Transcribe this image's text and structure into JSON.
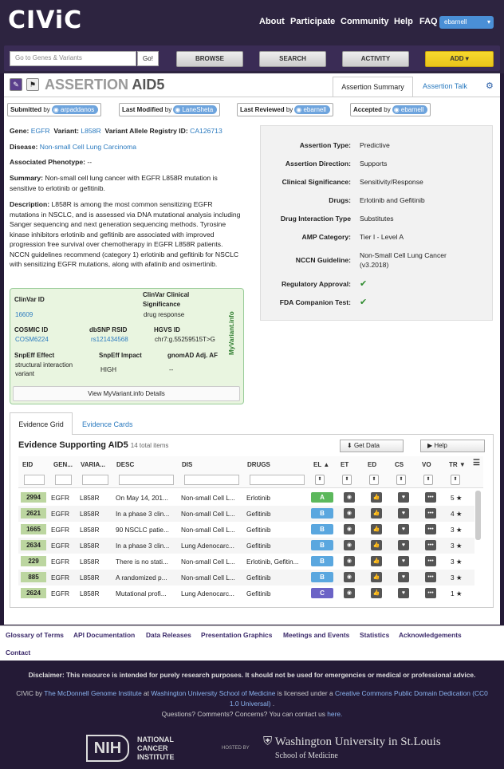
{
  "header": {
    "logo": "CIViC",
    "nav": [
      "About",
      "Participate",
      "Community",
      "Help",
      "FAQ"
    ],
    "user": "ebarnell"
  },
  "toolbar": {
    "search_placeholder": "Go to Genes & Variants",
    "go": "Go!",
    "browse": "BROWSE",
    "search": "SEARCH",
    "activity": "ACTIVITY",
    "add": "ADD"
  },
  "assertion": {
    "label": "ASSERTION",
    "id": "AID5"
  },
  "tabs": {
    "summary": "Assertion Summary",
    "talk": "Assertion Talk"
  },
  "chips": {
    "submitted": "Submitted",
    "submitted_user": "arpaddanos",
    "modified": "Last Modified",
    "modified_user": "LaneSheta",
    "reviewed": "Last Reviewed",
    "reviewed_user": "ebarnell",
    "accepted": "Accepted",
    "accepted_user": "ebarnell",
    "by": "by"
  },
  "fields": {
    "gene_label": "Gene:",
    "gene": "EGFR",
    "variant_label": "Variant:",
    "variant": "L858R",
    "registry_label": "Variant Allele Registry ID:",
    "registry": "CA126713",
    "disease_label": "Disease:",
    "disease": "Non-small Cell Lung Carcinoma",
    "phenotype_label": "Associated Phenotype:",
    "phenotype": "--",
    "summary_label": "Summary:",
    "summary": "Non-small cell lung cancer with EGFR L858R mutation is sensitive to erlotinib or gefitinib.",
    "description_label": "Description:",
    "description": "L858R is among the most common sensitizing EGFR mutations in NSCLC, and is assessed via DNA mutational analysis including Sanger sequencing and next generation sequencing methods. Tyrosine kinase inhibitors erlotinib and gefitinib are associated with improved progression free survival over chemotherapy in EGFR L858R patients. NCCN guidelines recommend (category 1) erlotinib and gefitinib for NSCLC with sensitizing EGFR mutations, along with afatinib and osimertinib."
  },
  "props": [
    {
      "k": "Assertion Type:",
      "v": "Predictive"
    },
    {
      "k": "Assertion Direction:",
      "v": "Supports"
    },
    {
      "k": "Clinical Significance:",
      "v": "Sensitivity/Response"
    },
    {
      "k": "Drugs:",
      "v": "Erlotinib and Gefitinib"
    },
    {
      "k": "Drug Interaction Type",
      "v": "Substitutes"
    },
    {
      "k": "AMP Category:",
      "v": "Tier I - Level A"
    },
    {
      "k": "NCCN Guideline:",
      "v": "Non-Small Cell Lung Cancer",
      "v2": "(v3.2018)"
    },
    {
      "k": "Regulatory Approval:",
      "v": "✔"
    },
    {
      "k": "FDA Companion Test:",
      "v": "✔"
    }
  ],
  "myvariant": {
    "clinvar_id_label": "ClinVar ID",
    "clinvar_id": "16609",
    "clinvar_sig_label": "ClinVar Clinical",
    "clinvar_sig_label2": "Significance",
    "clinvar_sig": "drug response",
    "cosmic_label": "COSMIC ID",
    "cosmic": "COSM6224",
    "dbsnp_label": "dbSNP RSID",
    "dbsnp": "rs121434568",
    "hgvs_label": "HGVS ID",
    "hgvs": "chr7:g.55259515T>G",
    "snpeff_effect_label": "SnpEff Effect",
    "snpeff_effect": "structural interaction variant",
    "snpeff_impact_label": "SnpEff Impact",
    "snpeff_impact": "HIGH",
    "gnomad_label": "gnomAD Adj. AF",
    "gnomad": "--",
    "side": "MyVariant.info",
    "details": "View MyVariant.info Details"
  },
  "evidence": {
    "tab_grid": "Evidence Grid",
    "tab_cards": "Evidence Cards",
    "title": "Evidence Supporting AID5",
    "count": "14 total items",
    "get_data": "Get Data",
    "help": "Help",
    "columns": [
      "EID",
      "GEN...",
      "VARIA...",
      "DESC",
      "DIS",
      "DRUGS",
      "EL",
      "ET",
      "ED",
      "CS",
      "VO",
      "TR"
    ],
    "rows": [
      {
        "eid": "2994",
        "gene": "EGFR",
        "var": "L858R",
        "desc": "On May 14, 201...",
        "dis": "Non-small Cell L...",
        "drugs": "Erlotinib",
        "el": "A",
        "tr": "5 ★"
      },
      {
        "eid": "2621",
        "gene": "EGFR",
        "var": "L858R",
        "desc": "In a phase 3 clin...",
        "dis": "Non-small Cell L...",
        "drugs": "Gefitinib",
        "el": "B",
        "tr": "4 ★"
      },
      {
        "eid": "1665",
        "gene": "EGFR",
        "var": "L858R",
        "desc": "90 NSCLC patie...",
        "dis": "Non-small Cell L...",
        "drugs": "Gefitinib",
        "el": "B",
        "tr": "3 ★"
      },
      {
        "eid": "2634",
        "gene": "EGFR",
        "var": "L858R",
        "desc": "In a phase 3 clin...",
        "dis": "Lung Adenocarc...",
        "drugs": "Gefitinib",
        "el": "B",
        "tr": "3 ★"
      },
      {
        "eid": "229",
        "gene": "EGFR",
        "var": "L858R",
        "desc": "There is no stati...",
        "dis": "Non-small Cell L...",
        "drugs": "Erlotinib, Gefitin...",
        "el": "B",
        "tr": "3 ★"
      },
      {
        "eid": "885",
        "gene": "EGFR",
        "var": "L858R",
        "desc": "A randomized p...",
        "dis": "Non-small Cell L...",
        "drugs": "Gefitinib",
        "el": "B",
        "tr": "3 ★"
      },
      {
        "eid": "2624",
        "gene": "EGFR",
        "var": "L858R",
        "desc": "Mutational profi...",
        "dis": "Lung Adenocarc...",
        "drugs": "Gefitinib",
        "el": "C",
        "tr": "1 ★"
      }
    ]
  },
  "colors": {
    "A": "#5cb85c",
    "B": "#5aa7df",
    "C": "#6b63c6"
  },
  "footer": {
    "links": [
      "Glossary of Terms",
      "API Documentation",
      "Data Releases",
      "Presentation Graphics",
      "Meetings and Events",
      "Statistics",
      "Acknowledgements",
      "Contact"
    ],
    "disclaimer": "Disclaimer: This resource is intended for purely research purposes. It should not be used for emergencies or medical or professional advice.",
    "lic1": "CIViC",
    "lic2": " by ",
    "lic3": "The McDonnell Genome Institute",
    "lic4": " at ",
    "lic5": "Washington University School of Medicine",
    "lic6": " is licensed under a ",
    "lic7": "Creative Commons Public Domain",
    "lic8": "Dedication (CC0 1.0 Universal)",
    "lic9": " .",
    "questions": "Questions? Comments? Concerns? You can contact us ",
    "here": "here.",
    "nih": "NIH",
    "nci1": "NATIONAL",
    "nci2": "CANCER",
    "nci3": "INSTITUTE",
    "hosted": "HOSTED BY",
    "wustl": "Washington University in St.Louis",
    "wustl2": "School of Medicine"
  }
}
